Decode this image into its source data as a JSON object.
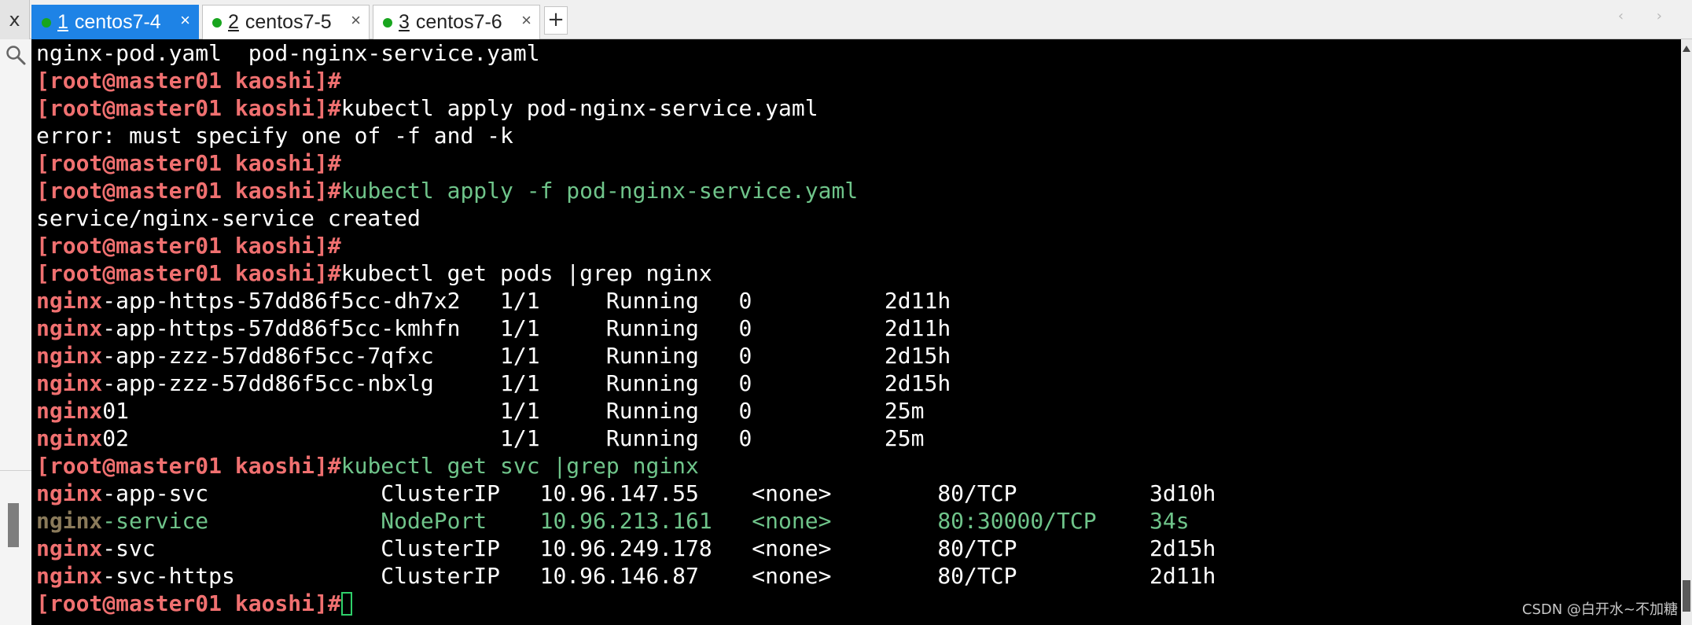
{
  "tabs": [
    {
      "number": "1",
      "label": "centos7-4",
      "active": true
    },
    {
      "number": "2",
      "label": "centos7-5",
      "active": false
    },
    {
      "number": "3",
      "label": "centos7-6",
      "active": false
    }
  ],
  "tab_close_glyph": "×",
  "tab_add_label": "+",
  "corner_close_glyph": "x",
  "nav_arrows": "‹ ›",
  "colors": {
    "terminal_bg": "#000000",
    "prompt": "#f07070",
    "text": "#ffffff",
    "selected": "#6fc48a",
    "active_tab": "#1e83e6"
  },
  "terminal": {
    "prompt": "[root@master01 kaoshi]#",
    "lines": [
      {
        "type": "out",
        "text": "nginx-pod.yaml  pod-nginx-service.yaml"
      },
      {
        "type": "prompt",
        "cmd": ""
      },
      {
        "type": "prompt",
        "cmd": "kubectl apply pod-nginx-service.yaml"
      },
      {
        "type": "out",
        "text": "error: must specify one of -f and -k"
      },
      {
        "type": "prompt",
        "cmd": ""
      },
      {
        "type": "prompt",
        "cmd": "kubectl apply -f pod-nginx-service.yaml",
        "selected": true
      },
      {
        "type": "out",
        "text": "service/nginx-service created"
      },
      {
        "type": "prompt",
        "cmd": ""
      },
      {
        "type": "prompt",
        "cmd": "kubectl get pods |grep nginx"
      },
      {
        "type": "match",
        "match": "nginx",
        "rest": "-app-https-57dd86f5cc-dh7x2   1/1     Running   0          2d11h"
      },
      {
        "type": "match",
        "match": "nginx",
        "rest": "-app-https-57dd86f5cc-kmhfn   1/1     Running   0          2d11h"
      },
      {
        "type": "match",
        "match": "nginx",
        "rest": "-app-zzz-57dd86f5cc-7qfxc     1/1     Running   0          2d15h"
      },
      {
        "type": "match",
        "match": "nginx",
        "rest": "-app-zzz-57dd86f5cc-nbxlg     1/1     Running   0          2d15h"
      },
      {
        "type": "match",
        "match": "nginx",
        "rest": "01                            1/1     Running   0          25m"
      },
      {
        "type": "match",
        "match": "nginx",
        "rest": "02                            1/1     Running   0          25m"
      },
      {
        "type": "prompt",
        "cmd": "kubectl get svc |grep nginx",
        "selected": true
      },
      {
        "type": "match",
        "match": "nginx",
        "rest": "-app-svc             ClusterIP   10.96.147.55    <none>        80/TCP          3d10h"
      },
      {
        "type": "match",
        "match": "nginx",
        "rest": "-service             NodePort    10.96.213.161   <none>        80:30000/TCP    34s",
        "selected": true
      },
      {
        "type": "match",
        "match": "nginx",
        "rest": "-svc                 ClusterIP   10.96.249.178   <none>        80/TCP          2d15h"
      },
      {
        "type": "match",
        "match": "nginx",
        "rest": "-svc-https           ClusterIP   10.96.146.87    <none>        80/TCP          2d11h"
      },
      {
        "type": "prompt",
        "cmd": "",
        "cursor": true
      }
    ]
  },
  "watermark": "CSDN @白开水~不加糖"
}
